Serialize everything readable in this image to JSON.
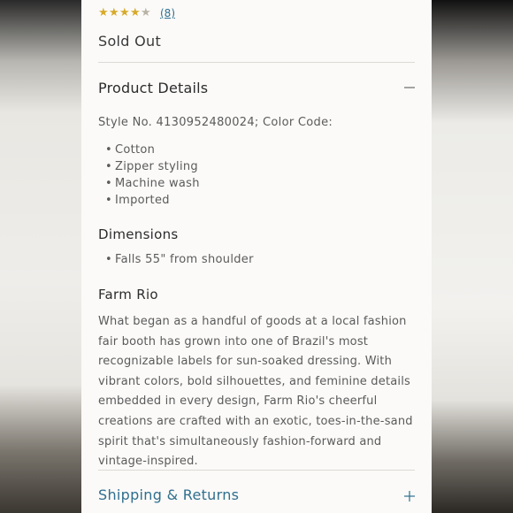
{
  "rating": {
    "value": 4.5,
    "max": 5,
    "count_label": "(8)"
  },
  "status": {
    "sold_out": "Sold Out"
  },
  "product_details": {
    "title": "Product Details",
    "style_line": "Style No. 4130952480024; Color Code:",
    "features": [
      "Cotton",
      "Zipper styling",
      "Machine wash",
      "Imported"
    ]
  },
  "dimensions": {
    "title": "Dimensions",
    "items": [
      "Falls 55\" from shoulder"
    ]
  },
  "brand": {
    "title": "Farm Rio",
    "description": "What began as a handful of goods at a local fashion fair booth has grown into one of Brazil's most recognizable labels for sun-soaked dressing. With vibrant colors, bold silhouettes, and feminine details embedded in every design, Farm Rio's cheerful creations are crafted with an exotic, toes-in-the-sand spirit that's simultaneously fashion-forward and vintage-inspired."
  },
  "shipping": {
    "title": "Shipping & Returns"
  },
  "icons": {
    "collapse": "minus-icon",
    "expand": "plus-icon",
    "rating": "star-icon"
  },
  "colors": {
    "accent": "#2f6f8f",
    "star": "#d7aa2a"
  }
}
